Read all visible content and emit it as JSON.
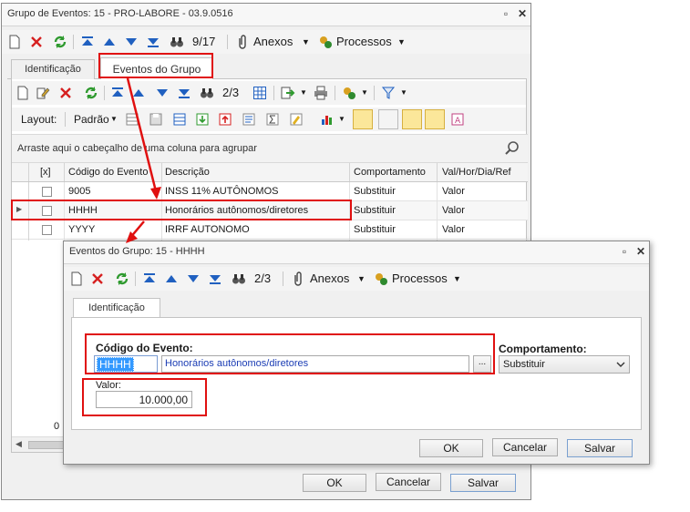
{
  "main_window": {
    "title": "Grupo de Eventos: 15 - PRO-LABORE - 03.9.0516",
    "record_counter": "9/17",
    "anexos_label": "Anexos",
    "processos_label": "Processos",
    "tabs": [
      "Identificação",
      "Eventos do Grupo"
    ],
    "ok_label": "OK",
    "cancel_label": "Cancelar",
    "save_label": "Salvar"
  },
  "grid": {
    "record_counter": "2/3",
    "layout_label": "Layout:",
    "layout_value": "Padrão",
    "group_hint": "Arraste aqui o cabeçalho de uma coluna para agrupar",
    "columns": [
      "[x]",
      "Código do Evento",
      "Descrição",
      "Comportamento",
      "Val/Hor/Dia/Ref"
    ],
    "rows": [
      {
        "codigo": "9005",
        "descricao": "INSS 11% AUTÔNOMOS",
        "comportamento": "Substituir",
        "val": "Valor"
      },
      {
        "codigo": "HHHH",
        "descricao": "Honorários autônomos/diretores",
        "comportamento": "Substituir",
        "val": "Valor"
      },
      {
        "codigo": "YYYY",
        "descricao": "IRRF AUTONOMO",
        "comportamento": "Substituir",
        "val": "Valor"
      }
    ],
    "footer_count": "0"
  },
  "dialog": {
    "title": "Eventos do Grupo: 15 - HHHH",
    "record_counter": "2/3",
    "anexos_label": "Anexos",
    "processos_label": "Processos",
    "tab": "Identificação",
    "codigo_label": "Código do Evento:",
    "codigo_value": "HHHH",
    "descricao_value": "Honorários autônomos/diretores",
    "lookup_label": "...",
    "comportamento_label": "Comportamento:",
    "comportamento_value": "Substituir",
    "valor_label": "Valor:",
    "valor_value": "10.000,00",
    "ok_label": "OK",
    "cancel_label": "Cancelar",
    "save_label": "Salvar"
  },
  "colors": {
    "highlight": "#e01010",
    "selection": "#3399ff",
    "link_text": "#1a3cb4"
  }
}
